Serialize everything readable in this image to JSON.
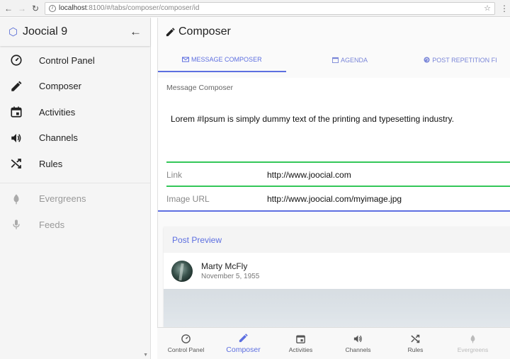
{
  "browser": {
    "back_icon": "arrow-left-icon",
    "forward_icon": "arrow-right-icon",
    "reload_icon": "reload-icon",
    "url_host": "localhost",
    "url_rest": ":8100/#/tabs/composer/composer/id",
    "star_icon": "star-icon"
  },
  "sidebar": {
    "app_title": "Joocial 9",
    "logo_icon": "hexagon-logo-icon",
    "back_icon": "arrow-left-icon",
    "items": [
      {
        "label": "Control Panel",
        "icon": "speedometer-icon"
      },
      {
        "label": "Composer",
        "icon": "pencil-icon"
      },
      {
        "label": "Activities",
        "icon": "calendar-icon"
      },
      {
        "label": "Channels",
        "icon": "speaker-icon"
      },
      {
        "label": "Rules",
        "icon": "shuffle-icon"
      }
    ],
    "secondary_items": [
      {
        "label": "Evergreens",
        "icon": "leaf-icon"
      },
      {
        "label": "Feeds",
        "icon": "microphone-icon"
      }
    ]
  },
  "main": {
    "title": "Composer",
    "tabs": [
      {
        "label": "MESSAGE COMPOSER",
        "icon": "envelope-icon",
        "active": true
      },
      {
        "label": "AGENDA",
        "icon": "calendar-icon",
        "active": false
      },
      {
        "label": "POST REPETITION FI",
        "icon": "repeat-icon",
        "active": false
      }
    ],
    "composer": {
      "label": "Message Composer",
      "text": "Lorem #Ipsum is simply dummy text of the printing and typesetting industry."
    },
    "fields": {
      "link_label": "Link",
      "link_value": "http://www.joocial.com",
      "image_label": "Image URL",
      "image_value": "http://www.joocial.com/myimage.jpg"
    },
    "preview": {
      "title": "Post Preview",
      "author_name": "Marty McFly",
      "author_date": "November 5, 1955"
    }
  },
  "bottom_tabs": [
    {
      "label": "Control Panel",
      "icon": "speedometer-icon"
    },
    {
      "label": "Composer",
      "icon": "pencil-icon"
    },
    {
      "label": "Activities",
      "icon": "calendar-icon"
    },
    {
      "label": "Channels",
      "icon": "speaker-icon"
    },
    {
      "label": "Rules",
      "icon": "shuffle-icon"
    },
    {
      "label": "Evergreens",
      "icon": "leaf-icon"
    }
  ],
  "colors": {
    "accent": "#5d6fe0",
    "valid_green": "#34c759",
    "muted": "#999999"
  }
}
